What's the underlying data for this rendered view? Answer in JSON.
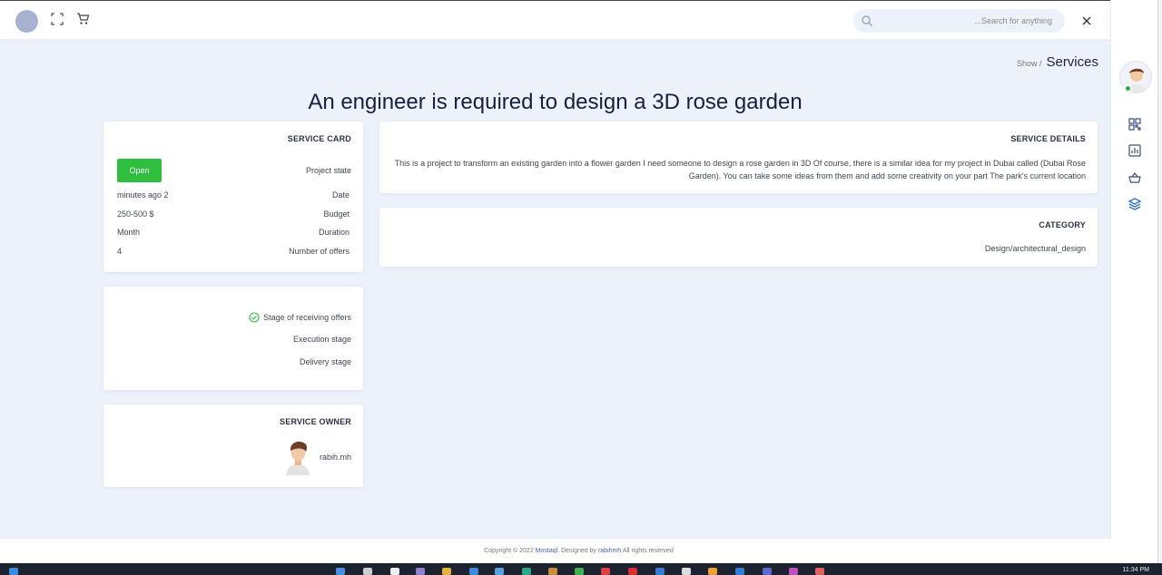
{
  "header": {
    "search_placeholder": "...Search for anything"
  },
  "breadcrumb": {
    "parent": "Show /",
    "current": "Services"
  },
  "page_title": "An engineer is required to design a 3D rose garden",
  "service_card": {
    "title": "SERVICE CARD",
    "status_button": "Open",
    "status_label": "Project state",
    "rows": [
      {
        "value": "minutes ago 2",
        "label": "Date"
      },
      {
        "value": "250-500 $",
        "label": "Budget"
      },
      {
        "value": "Month",
        "label": "Duration"
      },
      {
        "value": "4",
        "label": "Number of offers"
      }
    ]
  },
  "stages": [
    {
      "label": "Stage of receiving offers",
      "done": true
    },
    {
      "label": "Execution stage",
      "done": false
    },
    {
      "label": "Delivery stage",
      "done": false
    }
  ],
  "owner": {
    "title": "SERVICE OWNER",
    "name": "rabih.mh"
  },
  "details": {
    "title": "SERVICE DETAILS",
    "text": "This is a project to transform an existing garden into a flower garden I need someone to design a rose garden in 3D Of course, there is a similar idea for my project in Dubai called (Dubai Rose Garden). You can take some ideas from them and add some creativity on your part The park's current location"
  },
  "category": {
    "title": "CATEGORY",
    "value": "Design/architectural_design"
  },
  "footer": {
    "prefix": "Copyright © 2022",
    "brand": "Mostaql",
    "middle": ". Designed by",
    "designer": "rabihmh",
    "suffix": "All rights reserved"
  },
  "taskbar": {
    "clock": "11:34 PM"
  },
  "colors": {
    "accent_green": "#2fbf3f",
    "title_navy": "#16213f",
    "page_bg": "#edf1fa"
  }
}
